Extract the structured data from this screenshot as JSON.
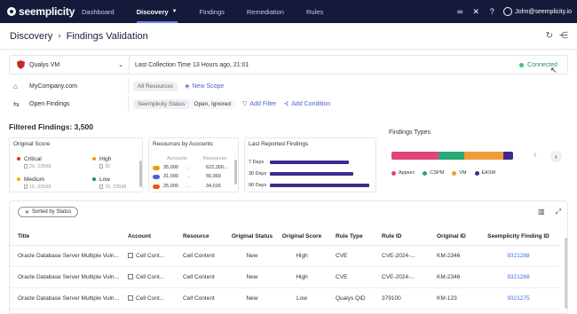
{
  "app": {
    "logo_text": "seemplicity"
  },
  "nav": {
    "items": [
      {
        "label": "Dashboard",
        "active": false
      },
      {
        "label": "Discovery",
        "active": true
      },
      {
        "label": "Findings",
        "active": false
      },
      {
        "label": "Remediation",
        "active": false
      },
      {
        "label": "Rules",
        "active": false
      }
    ],
    "user": "John@seemplicity.io"
  },
  "header": {
    "breadcrumb_root": "Discovery",
    "breadcrumb_current": "Findings Validation"
  },
  "scanner": {
    "name": "Qualys VM",
    "collection": "Last Collection Time 13 Hours ago, 21:01",
    "status": "Connected"
  },
  "scope": {
    "org": "MyCompany.com",
    "chip": "All Resources",
    "new_scope": "New Scope"
  },
  "filters": {
    "label": "Open Findings",
    "cond_key": "Seemplicity Status",
    "cond_value": "Open, Ignored",
    "add_filter": "Add Filter",
    "add_condition": "Add Condition"
  },
  "filtered_findings": "Filtered Findings: 3,500",
  "original_score": {
    "title": "Original Score",
    "items": [
      {
        "label": "Critical",
        "sub": "20, 23568",
        "color": "#d93025"
      },
      {
        "label": "High",
        "sub": "35",
        "color": "#f29900"
      },
      {
        "label": "Medium",
        "sub": "15, 23568",
        "color": "#f9ab00"
      },
      {
        "label": "Low",
        "sub": "70, 23568",
        "color": "#1e8e3e"
      }
    ]
  },
  "resources_by_accounts": {
    "title": "Resources by Accounts",
    "col_accounts": "Accounts",
    "col_resources": "Resources",
    "rows": [
      {
        "accounts": "35,000",
        "resources": "622,300...",
        "color": "#f29900"
      },
      {
        "accounts": "31,000",
        "resources": "55,069",
        "color": "#4c5fd5"
      },
      {
        "accounts": "25,000",
        "resources": "34,015",
        "color": "#e8590c"
      }
    ]
  },
  "last_reported": {
    "title": "Last Reported Findings",
    "rows": [
      {
        "label": "7 Days",
        "value": 0.77
      },
      {
        "label": "30 Days",
        "value": 0.82
      },
      {
        "label": "90 Days",
        "value": 0.97
      }
    ]
  },
  "findings_types": {
    "title": "Findings Types",
    "segments": [
      {
        "label": "Appsec",
        "share": 0.39,
        "color": "#e0447c"
      },
      {
        "label": "CSPM",
        "share": 0.21,
        "color": "#2aa876"
      },
      {
        "label": "VM",
        "share": 0.32,
        "color": "#f29b38"
      },
      {
        "label": "EASM",
        "share": 0.08,
        "color": "#3b2c8f"
      }
    ]
  },
  "table": {
    "sorted_label": "Sorted by Status",
    "columns": [
      "Title",
      "Account",
      "Resource",
      "Original Status",
      "Original Score",
      "Rule Type",
      "Rule ID",
      "Original ID",
      "Seemplicity Finding ID"
    ],
    "rows": [
      {
        "title": "Oracle Database Server Multiple Vuln...",
        "account": "Cell Cont...",
        "resource": "Cell Content",
        "status": "New",
        "score": "High",
        "rule_type": "CVE",
        "rule_id": "CVE-2024-...",
        "original_id": "KM-2346",
        "finding_id": "9321288"
      },
      {
        "title": "Oracle Database Server Multiple Vuln...",
        "account": "Cell Cont...",
        "resource": "Cell Content",
        "status": "New",
        "score": "High",
        "rule_type": "CVE",
        "rule_id": "CVE-2024-...",
        "original_id": "KM-2346",
        "finding_id": "9321288"
      },
      {
        "title": "Oracle Database Server Multiple Vuln...",
        "account": "Cell Cont...",
        "resource": "Cell Content",
        "status": "New",
        "score": "Low",
        "rule_type": "Qualys QID",
        "rule_id": "379100",
        "original_id": "KM-123",
        "finding_id": "9321275"
      }
    ]
  }
}
